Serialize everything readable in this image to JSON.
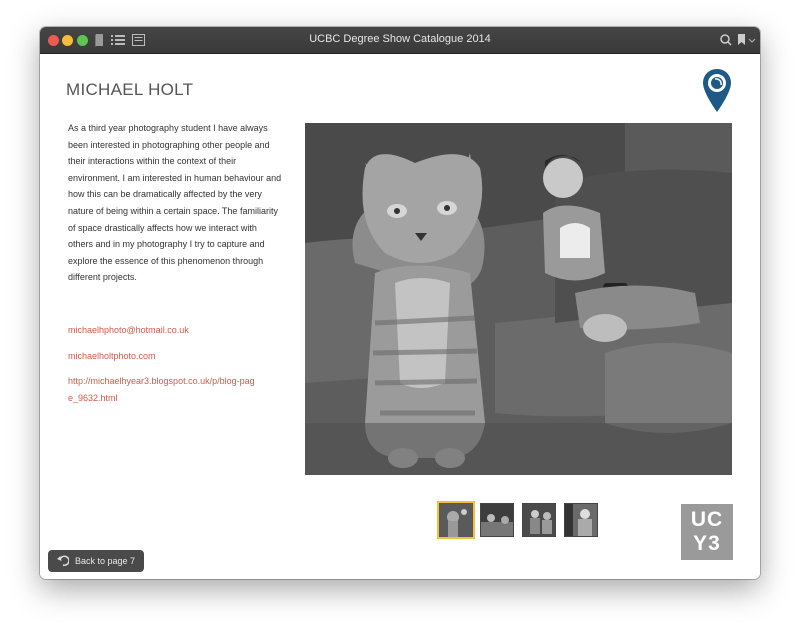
{
  "window": {
    "title": "UCBC Degree Show Catalogue 2014"
  },
  "page": {
    "name": "MICHAEL HOLT",
    "bio": "As a third year photography student I have always been interested in photographing other people and their interactions within the context of their environment. I am interested in human behaviour and how this can be dramatically affected by the very nature of being within a certain space. The familiarity of space drastically affects how we interact with others and in my photography I try to capture and explore the essence of this phenomenon through different projects.",
    "links": {
      "email": "michaelhphoto@hotmail.co.uk",
      "website": "michaelholtphoto.com",
      "blog": "http://michaelhyear3.blogspot.co.uk/p/blog-page_9632.html"
    },
    "photo_description_icon": "cat-and-boy-on-sofa-photo",
    "thumbnails": [
      "thumb-1",
      "thumb-2",
      "thumb-3",
      "thumb-4"
    ],
    "selected_thumbnail": 1,
    "logo": {
      "line1": "UC",
      "line2": "Y3"
    },
    "back_button": "Back to page 7"
  },
  "colors": {
    "link": "#cf5b4a",
    "selected": "#f0c040",
    "pin": "#1e5a86"
  }
}
